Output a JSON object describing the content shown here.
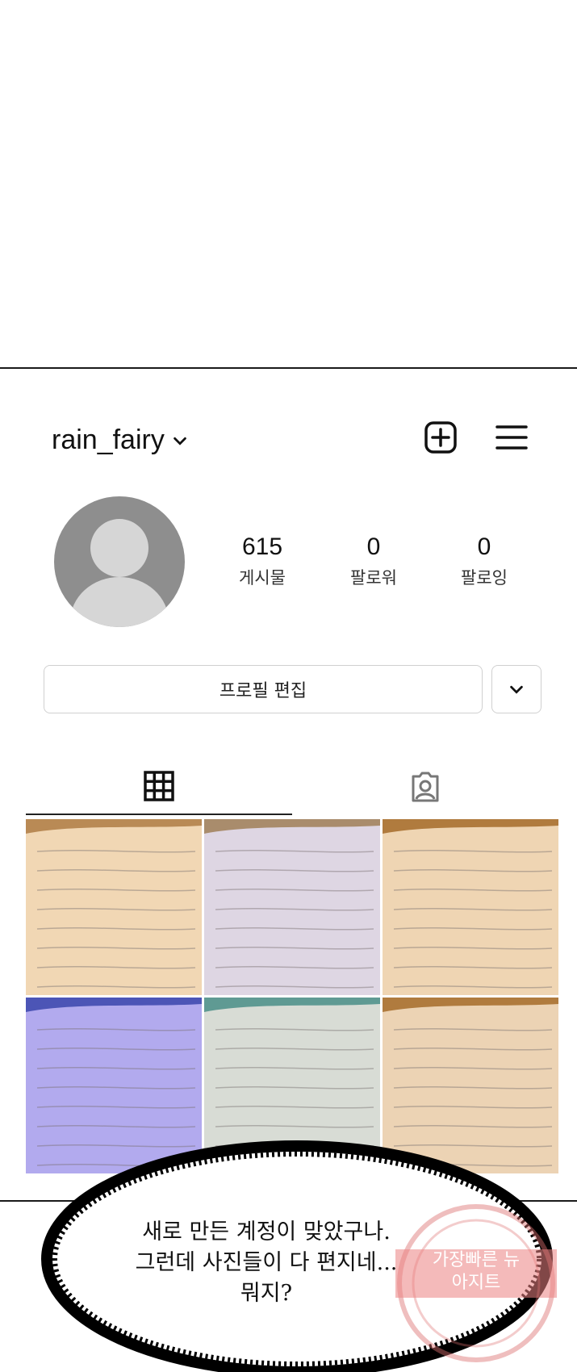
{
  "profile": {
    "username": "rain_fairy",
    "stats": [
      {
        "value": "615",
        "label": "게시물"
      },
      {
        "value": "0",
        "label": "팔로워"
      },
      {
        "value": "0",
        "label": "팔로잉"
      }
    ],
    "edit_button": "프로필 편집"
  },
  "icons": {
    "add": "plus-square-icon",
    "menu": "hamburger-menu-icon",
    "grid": "grid-icon",
    "tagged": "tagged-person-icon"
  },
  "posts_colors": [
    {
      "paper": "#f1d7b4",
      "tape": "#b98a55"
    },
    {
      "paper": "#ded6e3",
      "tape": "#a98c6c"
    },
    {
      "paper": "#efd5b3",
      "tape": "#b07b3e"
    },
    {
      "paper": "#b2aaee",
      "tape": "#4c55b6"
    },
    {
      "paper": "#d8dcd5",
      "tape": "#5f9a93"
    },
    {
      "paper": "#ecd3b4",
      "tape": "#b07b3e"
    }
  ],
  "bubble": {
    "lines": [
      "새로 만든 계정이 맞았구나.",
      "그런데 사진들이 다 편지네...",
      "뭐지?"
    ]
  },
  "watermark": {
    "lines": [
      "가장빠른 뉴",
      "아지트"
    ]
  }
}
